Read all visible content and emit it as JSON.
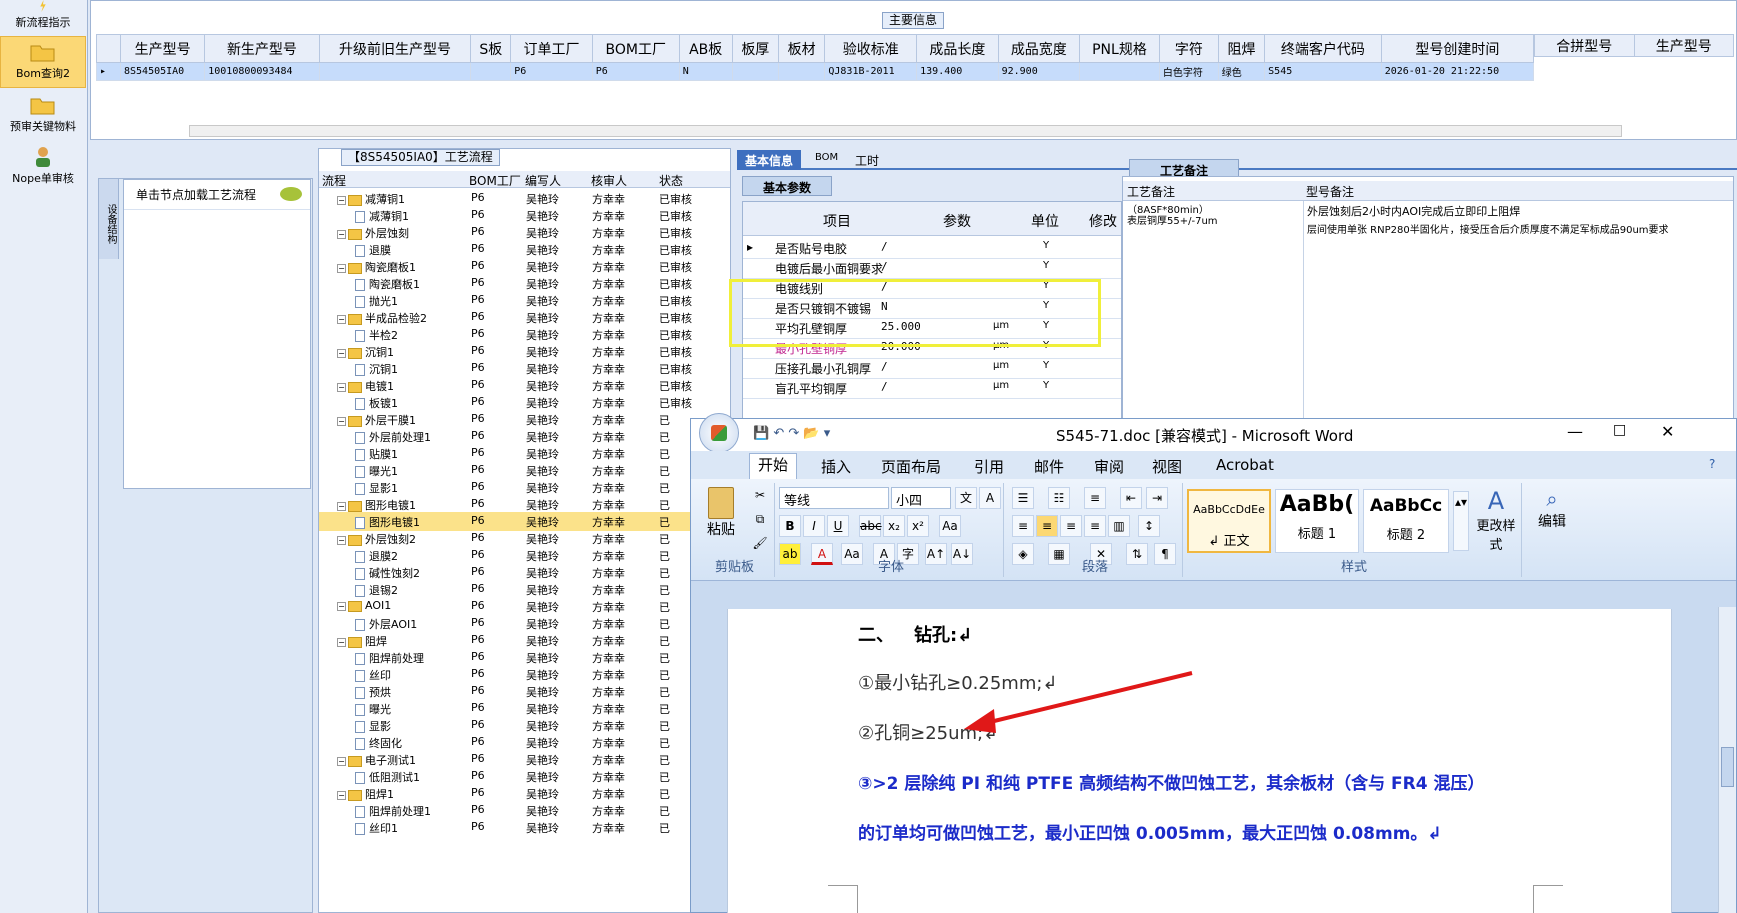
{
  "leftbar": {
    "items": [
      {
        "label": "新流程指示",
        "icon": "lightning-icon"
      },
      {
        "label": "Bom查询2",
        "icon": "folder-open-icon"
      },
      {
        "label": "预审关键物料",
        "icon": "folder-open-icon"
      },
      {
        "label": "Nope单审核",
        "icon": "user-icon"
      }
    ]
  },
  "main_info": {
    "title": "主要信息",
    "columns": [
      "生产型号",
      "新生产型号",
      "升级前旧生产型号",
      "S板",
      "订单工厂",
      "BOM工厂",
      "AB板",
      "板厚",
      "板材",
      "验收标准",
      "成品长度",
      "成品宽度",
      "PNL规格",
      "字符",
      "阻焊",
      "终端客户代码",
      "型号创建时间"
    ],
    "row": [
      "8S54505IA0",
      "10010800093484",
      "",
      "",
      "P6",
      "P6",
      "N",
      "",
      "",
      "QJ831B-2011",
      "139.400",
      "92.900",
      "",
      "白色字符",
      "绿色",
      "S545",
      "2026-01-20 21:22:50"
    ],
    "merge_columns": [
      "合拼型号",
      "生产型号"
    ]
  },
  "load_pane": {
    "vertical_tab": "设备结构",
    "hint": "单击节点加载工艺流程"
  },
  "flow": {
    "title": "【8S54505IA0】工艺流程",
    "columns": [
      "流程",
      "BOM工厂",
      "编写人",
      "核审人",
      "状态"
    ],
    "rows": [
      {
        "name": "减薄铜1",
        "level": 0,
        "bom": "P6",
        "writer": "吴艳玲",
        "checker": "方幸幸",
        "status": "已审核"
      },
      {
        "name": "减薄铜1",
        "level": 1,
        "bom": "P6",
        "writer": "吴艳玲",
        "checker": "方幸幸",
        "status": "已审核"
      },
      {
        "name": "外层蚀刻",
        "level": 0,
        "bom": "P6",
        "writer": "吴艳玲",
        "checker": "方幸幸",
        "status": "已审核"
      },
      {
        "name": "退膜",
        "level": 1,
        "bom": "P6",
        "writer": "吴艳玲",
        "checker": "方幸幸",
        "status": "已审核"
      },
      {
        "name": "陶瓷磨板1",
        "level": 0,
        "bom": "P6",
        "writer": "吴艳玲",
        "checker": "方幸幸",
        "status": "已审核"
      },
      {
        "name": "陶瓷磨板1",
        "level": 1,
        "bom": "P6",
        "writer": "吴艳玲",
        "checker": "方幸幸",
        "status": "已审核"
      },
      {
        "name": "抛光1",
        "level": 1,
        "bom": "P6",
        "writer": "吴艳玲",
        "checker": "方幸幸",
        "status": "已审核"
      },
      {
        "name": "半成品检验2",
        "level": 0,
        "bom": "P6",
        "writer": "吴艳玲",
        "checker": "方幸幸",
        "status": "已审核"
      },
      {
        "name": "半检2",
        "level": 1,
        "bom": "P6",
        "writer": "吴艳玲",
        "checker": "方幸幸",
        "status": "已审核"
      },
      {
        "name": "沉铜1",
        "level": 0,
        "bom": "P6",
        "writer": "吴艳玲",
        "checker": "方幸幸",
        "status": "已审核"
      },
      {
        "name": "沉铜1",
        "level": 1,
        "bom": "P6",
        "writer": "吴艳玲",
        "checker": "方幸幸",
        "status": "已审核"
      },
      {
        "name": "电镀1",
        "level": 0,
        "bom": "P6",
        "writer": "吴艳玲",
        "checker": "方幸幸",
        "status": "已审核"
      },
      {
        "name": "板镀1",
        "level": 1,
        "bom": "P6",
        "writer": "吴艳玲",
        "checker": "方幸幸",
        "status": "已审核"
      },
      {
        "name": "外层干膜1",
        "level": 0,
        "bom": "P6",
        "writer": "吴艳玲",
        "checker": "方幸幸",
        "status": "已"
      },
      {
        "name": "外层前处理1",
        "level": 1,
        "bom": "P6",
        "writer": "吴艳玲",
        "checker": "方幸幸",
        "status": "已"
      },
      {
        "name": "贴膜1",
        "level": 1,
        "bom": "P6",
        "writer": "吴艳玲",
        "checker": "方幸幸",
        "status": "已"
      },
      {
        "name": "曝光1",
        "level": 1,
        "bom": "P6",
        "writer": "吴艳玲",
        "checker": "方幸幸",
        "status": "已"
      },
      {
        "name": "显影1",
        "level": 1,
        "bom": "P6",
        "writer": "吴艳玲",
        "checker": "方幸幸",
        "status": "已"
      },
      {
        "name": "图形电镀1",
        "level": 0,
        "bom": "P6",
        "writer": "吴艳玲",
        "checker": "方幸幸",
        "status": "已"
      },
      {
        "name": "图形电镀1",
        "level": 1,
        "bom": "P6",
        "writer": "吴艳玲",
        "checker": "方幸幸",
        "status": "已",
        "selected": true
      },
      {
        "name": "外层蚀刻2",
        "level": 0,
        "bom": "P6",
        "writer": "吴艳玲",
        "checker": "方幸幸",
        "status": "已"
      },
      {
        "name": "退膜2",
        "level": 1,
        "bom": "P6",
        "writer": "吴艳玲",
        "checker": "方幸幸",
        "status": "已"
      },
      {
        "name": "碱性蚀刻2",
        "level": 1,
        "bom": "P6",
        "writer": "吴艳玲",
        "checker": "方幸幸",
        "status": "已"
      },
      {
        "name": "退锡2",
        "level": 1,
        "bom": "P6",
        "writer": "吴艳玲",
        "checker": "方幸幸",
        "status": "已"
      },
      {
        "name": "AOI1",
        "level": 0,
        "bom": "P6",
        "writer": "吴艳玲",
        "checker": "方幸幸",
        "status": "已"
      },
      {
        "name": "外层AOI1",
        "level": 1,
        "bom": "P6",
        "writer": "吴艳玲",
        "checker": "方幸幸",
        "status": "已"
      },
      {
        "name": "阻焊",
        "level": 0,
        "bom": "P6",
        "writer": "吴艳玲",
        "checker": "方幸幸",
        "status": "已"
      },
      {
        "name": "阻焊前处理",
        "level": 1,
        "bom": "P6",
        "writer": "吴艳玲",
        "checker": "方幸幸",
        "status": "已"
      },
      {
        "name": "丝印",
        "level": 1,
        "bom": "P6",
        "writer": "吴艳玲",
        "checker": "方幸幸",
        "status": "已"
      },
      {
        "name": "预烘",
        "level": 1,
        "bom": "P6",
        "writer": "吴艳玲",
        "checker": "方幸幸",
        "status": "已"
      },
      {
        "name": "曝光",
        "level": 1,
        "bom": "P6",
        "writer": "吴艳玲",
        "checker": "方幸幸",
        "status": "已"
      },
      {
        "name": "显影",
        "level": 1,
        "bom": "P6",
        "writer": "吴艳玲",
        "checker": "方幸幸",
        "status": "已"
      },
      {
        "name": "终固化",
        "level": 1,
        "bom": "P6",
        "writer": "吴艳玲",
        "checker": "方幸幸",
        "status": "已"
      },
      {
        "name": "电子测试1",
        "level": 0,
        "bom": "P6",
        "writer": "吴艳玲",
        "checker": "方幸幸",
        "status": "已"
      },
      {
        "name": "低阻测试1",
        "level": 1,
        "bom": "P6",
        "writer": "吴艳玲",
        "checker": "方幸幸",
        "status": "已"
      },
      {
        "name": "阻焊1",
        "level": 0,
        "bom": "P6",
        "writer": "吴艳玲",
        "checker": "方幸幸",
        "status": "已"
      },
      {
        "name": "阻焊前处理1",
        "level": 1,
        "bom": "P6",
        "writer": "吴艳玲",
        "checker": "方幸幸",
        "status": "已"
      },
      {
        "name": "丝印1",
        "level": 1,
        "bom": "P6",
        "writer": "吴艳玲",
        "checker": "方幸幸",
        "status": "已"
      }
    ]
  },
  "right_panel": {
    "tabs": [
      "基本信息",
      "BOM",
      "工时"
    ],
    "subtab": "基本参数",
    "notes_tab": "工艺备注",
    "param_columns": [
      "项目",
      "参数",
      "单位",
      "修改"
    ],
    "params": [
      {
        "item": "是否贴号电胶",
        "value": "/",
        "unit": "",
        "mod": "Y",
        "red": false
      },
      {
        "item": "电镀后最小面铜要求",
        "value": "/",
        "unit": "",
        "mod": "Y",
        "red": false
      },
      {
        "item": "电镀线别",
        "value": "/",
        "unit": "",
        "mod": "Y",
        "red": false
      },
      {
        "item": "是否只镀铜不镀锡",
        "value": "N",
        "unit": "",
        "mod": "Y",
        "red": false
      },
      {
        "item": "平均孔壁铜厚",
        "value": "25.000",
        "unit": "μm",
        "mod": "Y",
        "red": false
      },
      {
        "item": "最小孔壁铜厚",
        "value": "20.000",
        "unit": "μm",
        "mod": "Y",
        "red": true
      },
      {
        "item": "压接孔最小孔铜厚",
        "value": "/",
        "unit": "μm",
        "mod": "Y",
        "red": false
      },
      {
        "item": "盲孔平均铜厚",
        "value": "/",
        "unit": "μm",
        "mod": "Y",
        "red": false
      }
    ],
    "notes_columns": [
      "工艺备注",
      "型号备注"
    ],
    "process_note": "（8ASF*80min）\n表层铜厚55+/-7um",
    "model_note_1": "外层蚀刻后2小时内AOI完成后立即印上阻焊",
    "model_note_2": "层间使用单张 RNP280半固化片，接受压合后介质厚度不满足军标成品90um要求"
  },
  "word": {
    "title": "S545-71.doc [兼容模式] - Microsoft Word",
    "tabs": [
      "开始",
      "插入",
      "页面布局",
      "引用",
      "邮件",
      "审阅",
      "视图",
      "Acrobat"
    ],
    "font_name": "等线",
    "font_size": "小四",
    "groups": [
      "剪贴板",
      "字体",
      "段落",
      "样式"
    ],
    "paste_label": "粘贴",
    "styles": [
      {
        "sample": "AaBbCcDdEe",
        "name": "↲ 正文"
      },
      {
        "sample": "AaBb(",
        "name": "标题 1"
      },
      {
        "sample": "AaBbCc",
        "name": "标题 2"
      }
    ],
    "change_styles": "更改样式",
    "edit": "编辑",
    "doc": {
      "heading_num": "二、",
      "heading": "钻孔:↲",
      "line1": "①最小钻孔≥0.25mm;↲",
      "line2": "②孔铜≥25um;↲",
      "line3": "③>2 层除纯 PI 和纯 PTFE 高频结构不做凹蚀工艺，其余板材（含与 FR4 混压）",
      "line4": "的订单均可做凹蚀工艺，最小正凹蚀 0.005mm，最大正凹蚀 0.08mm。↲"
    }
  }
}
